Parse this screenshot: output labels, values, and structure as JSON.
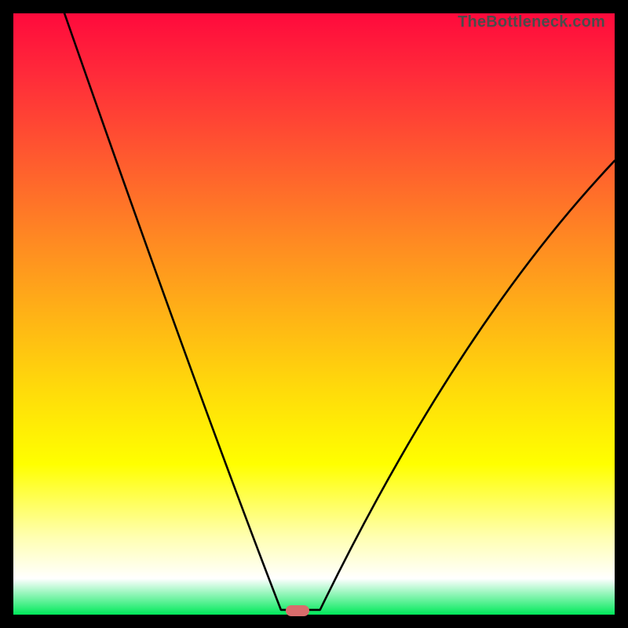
{
  "attribution": "TheBottleneck.com",
  "marker": {
    "x_frac": 0.472,
    "y_frac": 0.993
  },
  "curve": {
    "left_start": {
      "x_frac": 0.085,
      "y_frac": 0.0
    },
    "left_ctrl": {
      "x_frac": 0.305,
      "y_frac": 0.63
    },
    "floor_start": {
      "x_frac": 0.445,
      "y_frac": 0.992
    },
    "floor_end": {
      "x_frac": 0.51,
      "y_frac": 0.992
    },
    "right_ctrl": {
      "x_frac": 0.74,
      "y_frac": 0.52
    },
    "right_end": {
      "x_frac": 1.0,
      "y_frac": 0.245
    }
  },
  "chart_data": {
    "type": "line",
    "title": "",
    "xlabel": "",
    "ylabel": "",
    "xlim": [
      0,
      1
    ],
    "ylim": [
      0,
      1
    ],
    "series": [
      {
        "name": "bottleneck-curve",
        "x": [
          0.085,
          0.15,
          0.22,
          0.29,
          0.36,
          0.42,
          0.445,
          0.51,
          0.56,
          0.64,
          0.73,
          0.82,
          0.91,
          1.0
        ],
        "y": [
          1.0,
          0.82,
          0.62,
          0.42,
          0.22,
          0.05,
          0.008,
          0.008,
          0.05,
          0.2,
          0.38,
          0.54,
          0.67,
          0.755
        ]
      }
    ],
    "annotations": [
      {
        "name": "optimal-marker",
        "x": 0.478,
        "y": 0.007
      }
    ],
    "legend": false,
    "grid": false
  }
}
